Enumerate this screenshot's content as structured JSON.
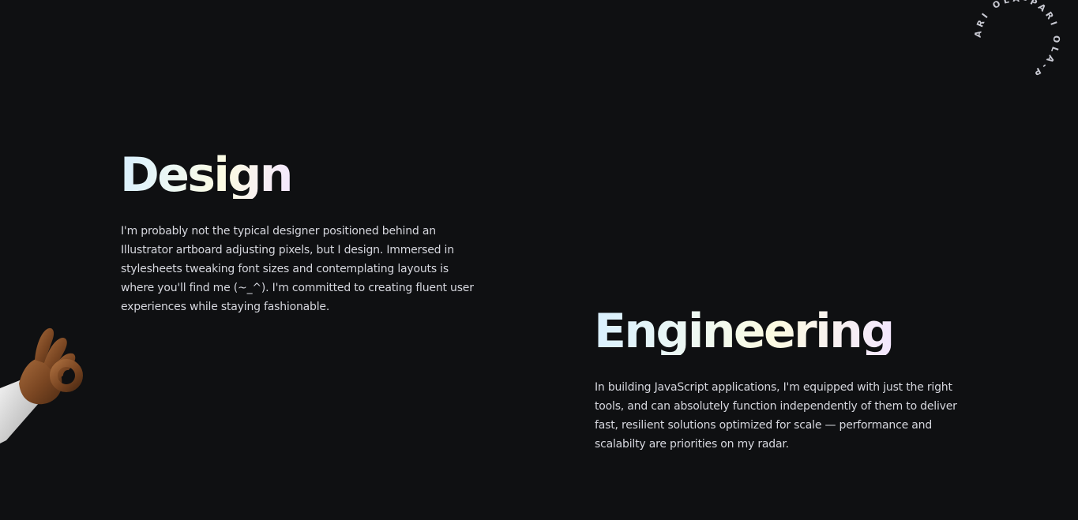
{
  "badge": {
    "ring_text": "ARI OLA-PARI OLA-P"
  },
  "icons": {
    "hand": "ok-hand-icon"
  },
  "design": {
    "title": "Design",
    "body": "I'm probably not the typical designer positioned behind an Illustrator artboard adjusting pixels, but I design. Immersed in stylesheets tweaking font sizes and contemplating layouts is where you'll find me (~_^). I'm committed to creating fluent user experiences while staying fashionable."
  },
  "engineering": {
    "title": "Engineering",
    "body": "In building JavaScript applications, I'm equipped with just the right tools, and can absolutely function independently of them to deliver fast, resilient solutions optimized for scale — performance and scalabilty are priorities on my radar."
  },
  "colors": {
    "background": "#0f1012",
    "text": "#d6d7de",
    "title_gradient": [
      "#d9f0ff",
      "#eef8f2",
      "#fcfbe2",
      "#f3e6ff"
    ]
  }
}
